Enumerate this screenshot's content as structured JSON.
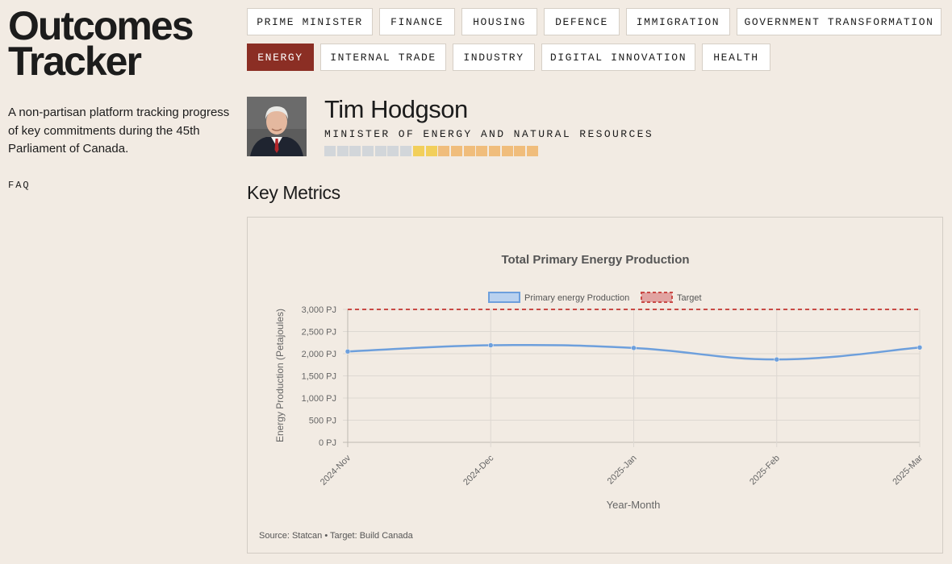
{
  "site": {
    "brand_line1": "Outcomes",
    "brand_line2": "Tracker",
    "tagline": "A non-partisan platform tracking progress of key commitments during the 45th Parliament of Canada.",
    "faq_label": "FAQ"
  },
  "nav": {
    "tabs_row1": [
      "Prime Minister",
      "Finance",
      "Housing",
      "Defence",
      "Immigration",
      "Government Transformation"
    ],
    "tabs_row2": [
      "Energy",
      "Internal Trade",
      "Industry",
      "Digital Innovation",
      "Health"
    ],
    "active_tab": "Energy"
  },
  "minister": {
    "name": "Tim Hodgson",
    "title": "Minister of Energy and Natural Resources",
    "progress_segments": [
      "grey",
      "grey",
      "grey",
      "grey",
      "grey",
      "grey",
      "grey",
      "yellow",
      "yellow",
      "orange",
      "orange",
      "orange",
      "orange",
      "orange",
      "orange",
      "orange",
      "orange"
    ],
    "segment_colors": {
      "grey": "#d2d6da",
      "yellow": "#f2cf5b",
      "orange": "#f0bd7c"
    }
  },
  "section": {
    "title": "Key Metrics"
  },
  "chart_data": {
    "type": "line",
    "title": "Total Primary Energy Production",
    "xlabel": "Year-Month",
    "ylabel": "Energy Production (Petajoules)",
    "categories": [
      "2024-Nov",
      "2024-Dec",
      "2025-Jan",
      "2025-Feb",
      "2025-Mar"
    ],
    "ylim": [
      0,
      3000
    ],
    "yticks": [
      0,
      500,
      1000,
      1500,
      2000,
      2500,
      3000
    ],
    "yunit": "PJ",
    "series": [
      {
        "name": "Primary energy Production",
        "values": [
          2050,
          2190,
          2130,
          1870,
          2140
        ],
        "color": "#6d9fdc",
        "style": "solid"
      },
      {
        "name": "Target",
        "values": [
          3000,
          3000,
          3000,
          3000,
          3000
        ],
        "color": "#c94a46",
        "style": "dashed"
      }
    ],
    "legend_position": "top-center",
    "grid": true,
    "source_note": "Source: Statcan • Target: Build Canada"
  }
}
